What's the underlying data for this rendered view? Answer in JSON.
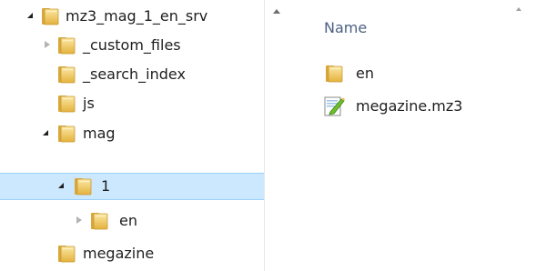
{
  "tree": {
    "items": [
      {
        "label": "mz3_mag_1_en_srv",
        "state": "expanded"
      },
      {
        "label": "_custom_files",
        "state": "collapsed"
      },
      {
        "label": "_search_index",
        "state": "leaf"
      },
      {
        "label": "js",
        "state": "leaf"
      },
      {
        "label": "mag",
        "state": "expanded"
      },
      {
        "label": "1",
        "state": "expanded",
        "selected": true
      },
      {
        "label": "en",
        "state": "collapsed"
      },
      {
        "label": "megazine",
        "state": "leaf"
      }
    ]
  },
  "content": {
    "column_header": "Name",
    "files": [
      {
        "name": "en",
        "icon": "folder-icon"
      },
      {
        "name": "megazine.mz3",
        "icon": "mz3-file-icon"
      }
    ]
  },
  "colors": {
    "selection_bg": "#cce8ff",
    "selection_border": "#99d1ff",
    "header_text": "#4d6082",
    "folder_yellow": "#f1c75b"
  }
}
